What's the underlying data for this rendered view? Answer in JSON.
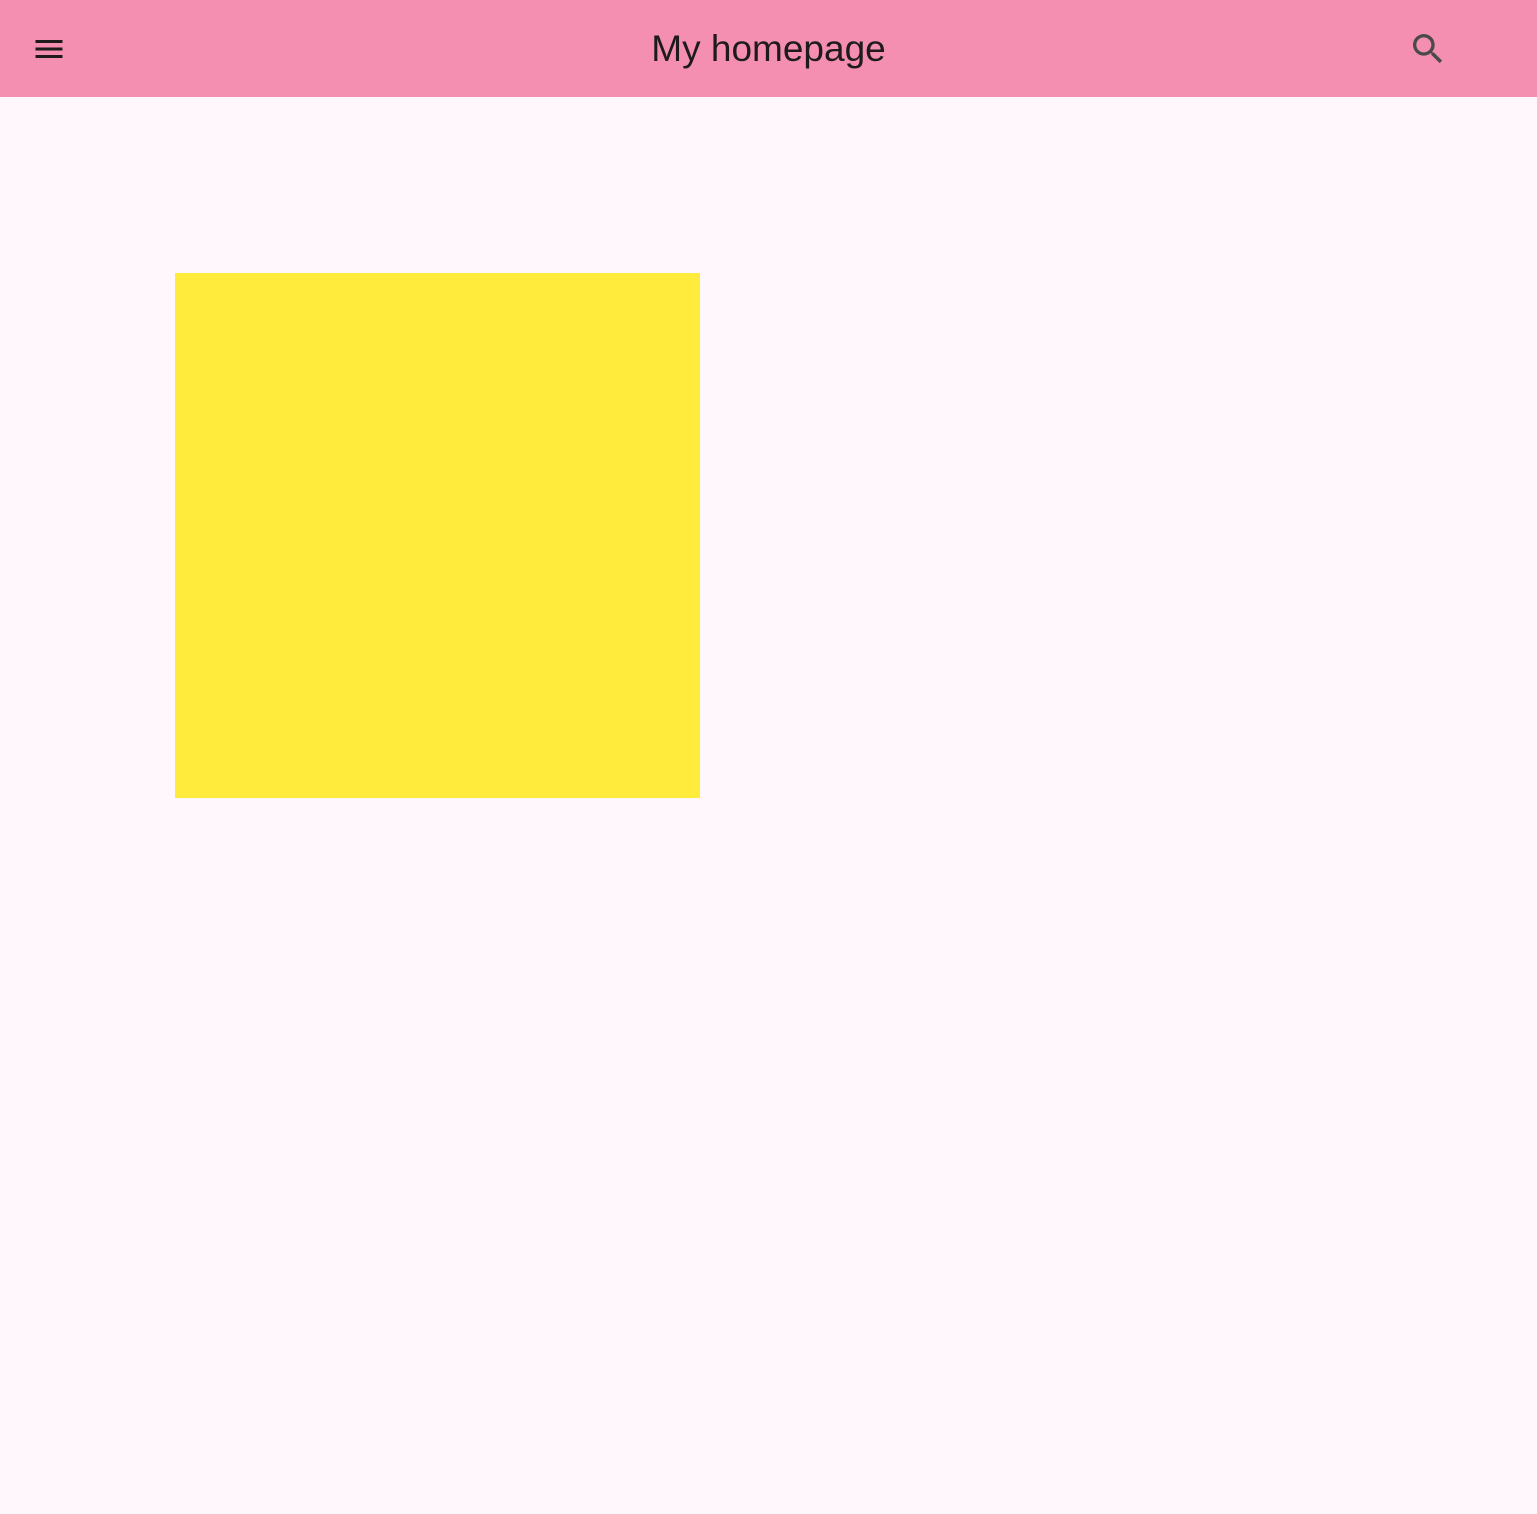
{
  "app_bar": {
    "title": "My homepage",
    "background_color": "#f48fb1",
    "leading_icon": "menu-icon",
    "trailing_icon": "search-icon"
  },
  "body": {
    "background_color": "#fff7fc",
    "box_color": "#ffeb3b"
  }
}
